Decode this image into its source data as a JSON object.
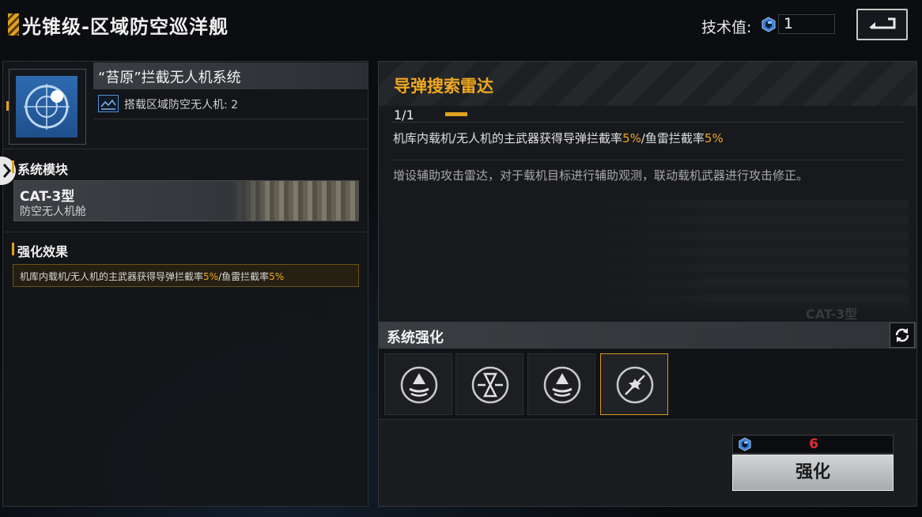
{
  "header": {
    "title": "光锥级-区域防空巡洋舰",
    "tech_label": "技术值:",
    "tech_value": "1"
  },
  "left": {
    "item_name": "“苔原”拦截无人机系统",
    "item_sub": "搭载区域防空无人机: 2",
    "section_module": "系统模块",
    "module_name": "CAT-3型",
    "module_type": "防空无人机舱",
    "section_effect": "强化效果",
    "effect_prefix": "机库内载机/无人机的主武器获得导弹拦截率",
    "effect_val1": "5%",
    "effect_mid": "/鱼雷拦截率",
    "effect_val2": "5%"
  },
  "right": {
    "title": "导弹搜索雷达",
    "level": "1/1",
    "effect_prefix": "机库内载机/无人机的主武器获得导弹拦截率",
    "effect_val1": "5%",
    "effect_mid": "/鱼雷拦截率",
    "effect_val2": "5%",
    "description": "增设辅助攻击雷达，对于载机目标进行辅助观测，联动载机武器进行攻击修正。",
    "watermark": "CAT-3型",
    "enhance_title": "系统强化",
    "slots": [
      "radar-dome",
      "missile-intercept",
      "radar-dome",
      "burst-strike"
    ],
    "selected_slot": 3,
    "cost": "6",
    "upgrade_label": "强化"
  },
  "colors": {
    "accent": "#e0a21e",
    "highlight": "#f0a820",
    "cost_red": "#e03030",
    "tech_blue": "#4f8fd8"
  }
}
